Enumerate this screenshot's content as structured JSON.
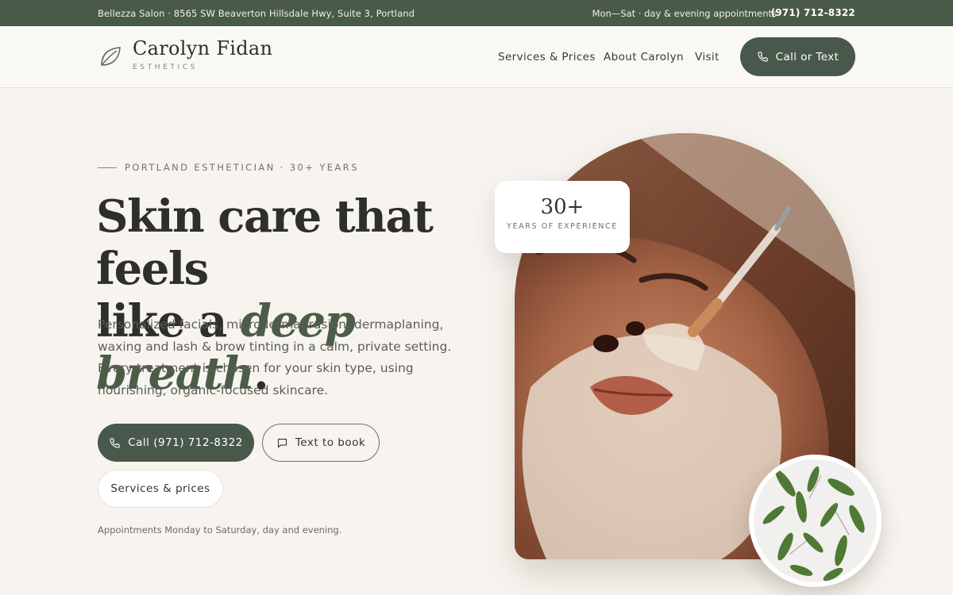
{
  "topbar": {
    "address": "Bellezza Salon · 8565 SW Beaverton Hillsdale Hwy, Suite 3, Portland",
    "hours": "Mon—Sat · day & evening appointments",
    "phone": "(971) 712-8322"
  },
  "brand": {
    "name": "Carolyn Fidan",
    "subtitle": "ESTHETICS",
    "logo_icon": "leaf-icon"
  },
  "nav": {
    "services": "Services & Prices",
    "about": "About Carolyn",
    "visit": "Visit",
    "cta_label": "Call or Text",
    "cta_icon": "phone-icon"
  },
  "hero": {
    "eyebrow": "PORTLAND ESTHETICIAN · 30+ YEARS",
    "headline_line1": "Skin care that feels",
    "headline_line2_start": "like a ",
    "headline_emphasis": "deep breath",
    "headline_end": ".",
    "intro": "Personalized facials, microdermabrasion, dermaplaning, waxing and lash & brow tinting in a calm, private setting. Every treatment is chosen for your skin type, using nourishing, organic-focused skincare.",
    "buttons": {
      "call": "Call (971) 712-8322",
      "text": "Text to book",
      "services": "Services & prices"
    },
    "note": "Appointments Monday to Saturday, day and evening."
  },
  "experience": {
    "number": "30+",
    "label": "YEARS OF EXPERIENCE"
  },
  "colors": {
    "accent": "#48584a",
    "topbar": "#4a5a48",
    "background": "#f7f4ef",
    "emphasis": "#4a5d47"
  }
}
